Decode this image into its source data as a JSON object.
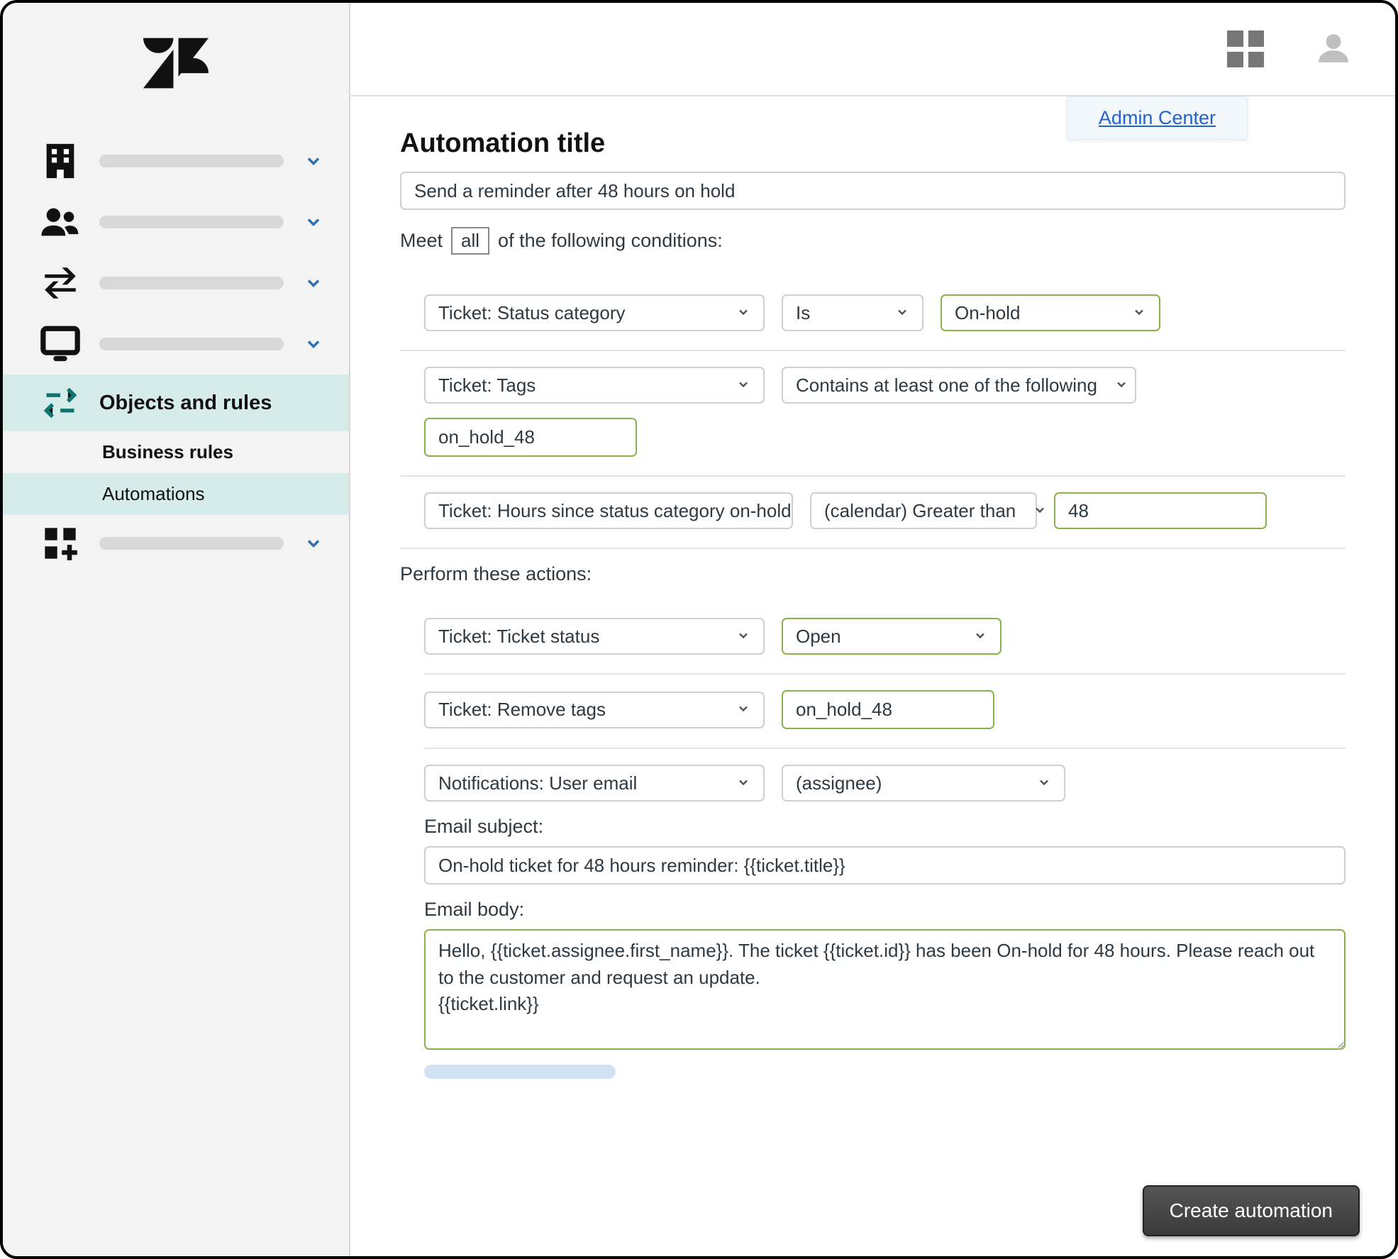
{
  "header": {
    "admin_center_label": "Admin Center"
  },
  "sidebar": {
    "active_section_label": "Objects and rules",
    "sub_items": [
      {
        "label": "Business rules",
        "active": false
      },
      {
        "label": "Automations",
        "active": true
      }
    ]
  },
  "page": {
    "title_label": "Automation title",
    "title_value": "Send a reminder after 48 hours on hold",
    "meet_prefix": "Meet",
    "meet_mode": "all",
    "meet_suffix": "of the following conditions:",
    "actions_label": "Perform these actions:",
    "create_button": "Create automation"
  },
  "conditions": [
    {
      "field": "Ticket: Status category",
      "operator": "Is",
      "value": "On-hold",
      "value_green": true
    },
    {
      "field": "Ticket: Tags",
      "operator": "Contains at least one of the following",
      "tag_value": "on_hold_48"
    },
    {
      "field": "Ticket: Hours since status category on-hold",
      "operator": "(calendar) Greater than",
      "numeric_value": "48"
    }
  ],
  "actions": [
    {
      "field": "Ticket: Ticket status",
      "value": "Open",
      "value_green": true
    },
    {
      "field": "Ticket: Remove tags",
      "tag_value": "on_hold_48"
    },
    {
      "field": "Notifications: User email",
      "recipient": "(assignee)"
    }
  ],
  "email": {
    "subject_label": "Email subject:",
    "subject_value": "On-hold ticket for 48 hours reminder: {{ticket.title}}",
    "body_label": "Email body:",
    "body_value": "Hello, {{ticket.assignee.first_name}}. The ticket {{ticket.id}} has been On-hold for 48 hours. Please reach out to the customer and request an update.\n{{ticket.link}}"
  }
}
